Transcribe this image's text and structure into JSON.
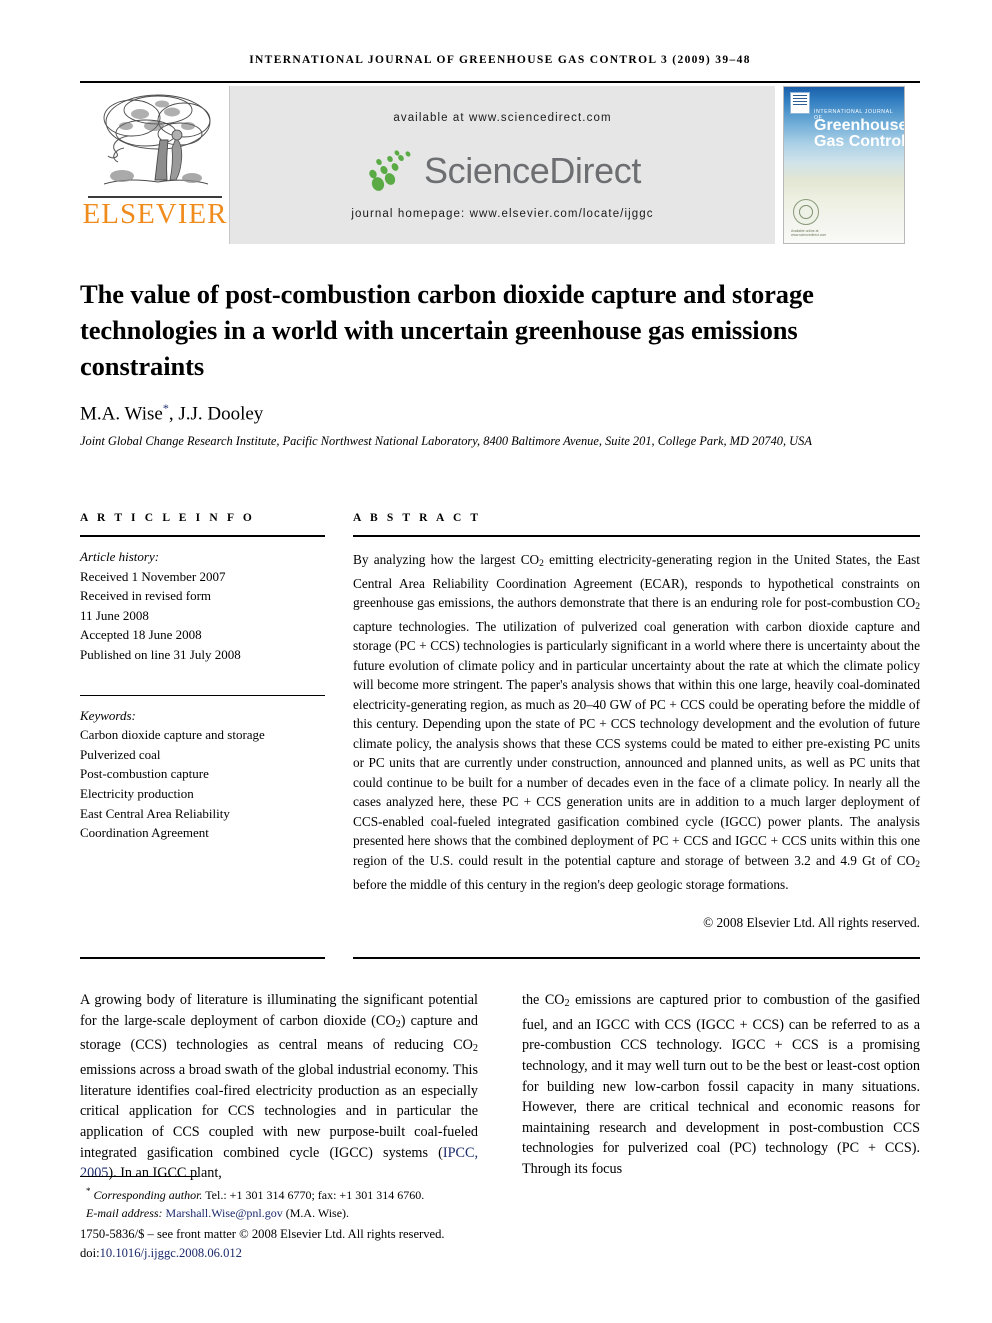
{
  "running_head": "International Journal of Greenhouse Gas Control 3 (2009) 39–48",
  "masthead": {
    "publisher_name": "ELSEVIER",
    "publisher_logo_icon": "elsevier-tree-logo",
    "available_at": "available at www.sciencedirect.com",
    "sciencedirect_wordmark": "ScienceDirect",
    "sciencedirect_leaves_icon": "sciencedirect-leaves-icon",
    "journal_homepage": "journal homepage: www.elsevier.com/locate/ijggc",
    "cover": {
      "kicker": "International Journal of",
      "title_line1": "Greenhouse",
      "title_line2": "Gas Control",
      "publisher_mark_icon": "elsevier-tree-mark-icon",
      "seal_icon": "certification-seal-icon",
      "seal_caption": "Available online at www.sciencedirect.com"
    },
    "colors": {
      "band_background": "#e6e6e6",
      "elsevier_orange": "#F08C1E",
      "sciencedirect_gray": "#6d6e71",
      "sciencedirect_green": "#5aab46",
      "cover_blue": "#1a5fa8"
    }
  },
  "article": {
    "title": "The value of post-combustion carbon dioxide capture and storage technologies in a world with uncertain greenhouse gas emissions constraints",
    "authors": "M.A. Wise",
    "corresponding_marker": "*",
    "authors_rest": ", J.J. Dooley",
    "affiliation": "Joint Global Change Research Institute, Pacific Northwest National Laboratory, 8400 Baltimore Avenue, Suite 201, College Park, MD 20740, USA"
  },
  "article_info": {
    "heading": "A R T I C L E   I N F O",
    "history_label": "Article history:",
    "history": [
      "Received 1 November 2007",
      "Received in revised form",
      "11 June 2008",
      "Accepted 18 June 2008",
      "Published on line 31 July 2008"
    ],
    "keywords_label": "Keywords:",
    "keywords": [
      "Carbon dioxide capture and storage",
      "Pulverized coal",
      "Post-combustion capture",
      "Electricity production",
      "East Central Area Reliability",
      "Coordination Agreement"
    ]
  },
  "abstract": {
    "heading": "A B S T R A C T",
    "paragraph_part1": "By analyzing how the largest CO",
    "paragraph_part2": " emitting electricity-generating region in the United States, the East Central Area Reliability Coordination Agreement (ECAR), responds to hypothetical constraints on greenhouse gas emissions, the authors demonstrate that there is an enduring role for post-combustion CO",
    "paragraph_part3": " capture technologies. The utilization of pulverized coal generation with carbon dioxide capture and storage (PC + CCS) technologies is particularly significant in a world where there is uncertainty about the future evolution of climate policy and in particular uncertainty about the rate at which the climate policy will become more stringent. The paper's analysis shows that within this one large, heavily coal-dominated electricity-generating region, as much as 20–40 GW of PC + CCS could be operating before the middle of this century. Depending upon the state of PC + CCS technology development and the evolution of future climate policy, the analysis shows that these CCS systems could be mated to either pre-existing PC units or PC units that are currently under construction, announced and planned units, as well as PC units that could continue to be built for a number of decades even in the face of a climate policy. In nearly all the cases analyzed here, these PC + CCS generation units are in addition to a much larger deployment of CCS-enabled coal-fueled integrated gasification combined cycle (IGCC) power plants. The analysis presented here shows that the combined deployment of PC + CCS and IGCC + CCS units within this one region of the U.S. could result in the potential capture and storage of between 3.2 and 4.9 Gt of CO",
    "paragraph_part4": " before the middle of this century in the region's deep geologic storage formations.",
    "copyright": "© 2008 Elsevier Ltd. All rights reserved."
  },
  "body": {
    "left_part1": "A growing body of literature is illuminating the significant potential for the large-scale deployment of carbon dioxide (CO",
    "left_part2": ") capture and storage (CCS) technologies as central means of reducing CO",
    "left_part3": " emissions across a broad swath of the global industrial economy. This literature identifies coal-fired electricity production as an especially critical application for CCS technologies and in particular the application of CCS coupled with new purpose-built coal-fueled integrated gasification combined cycle (IGCC) systems (",
    "left_citation": "IPCC, 2005",
    "left_part4": "). In an IGCC plant,",
    "right_part1": "the CO",
    "right_part2": " emissions are captured prior to combustion of the gasified fuel, and an IGCC with CCS (IGCC + CCS) can be referred to as a pre-combustion CCS technology. IGCC + CCS is a promising technology, and it may well turn out to be the best or least-cost option for building new low-carbon fossil capacity in many situations. However, there are critical technical and economic reasons for maintaining research and development in post-combustion CCS technologies for pulverized coal (PC) technology (PC + CCS). Through its focus"
  },
  "footer": {
    "corresponding_label": "Corresponding author.",
    "corresponding_contact": " Tel.: +1 301 314 6770; fax: +1 301 314 6760.",
    "email_label": "E-mail address:",
    "email_link": "Marshall.Wise@pnl.gov",
    "email_attribution": " (M.A. Wise).",
    "issn_line": "1750-5836/$ – see front matter © 2008 Elsevier Ltd. All rights reserved.",
    "doi_label": "doi:",
    "doi_value": "10.1016/j.ijggc.2008.06.012"
  }
}
